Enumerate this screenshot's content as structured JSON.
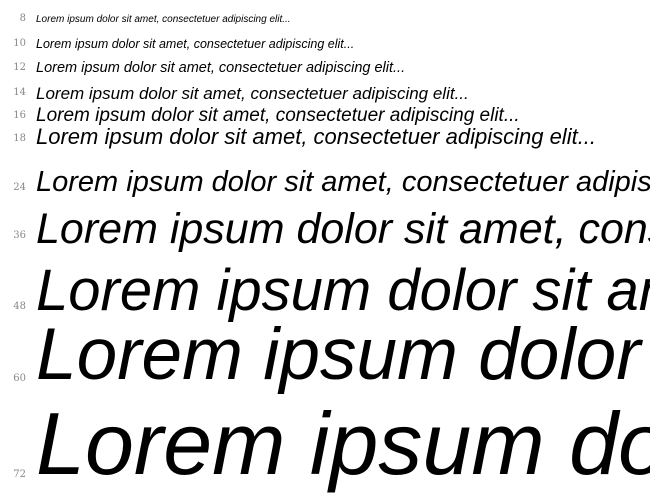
{
  "sample_text": "Lorem ipsum dolor sit amet, consectetuer adipiscing elit...",
  "rows": [
    {
      "size": "8"
    },
    {
      "size": "10"
    },
    {
      "size": "12"
    },
    {
      "size": "14"
    },
    {
      "size": "16"
    },
    {
      "size": "18"
    },
    {
      "size": "24"
    },
    {
      "size": "36"
    },
    {
      "size": "48"
    },
    {
      "size": "60"
    },
    {
      "size": "72"
    }
  ]
}
